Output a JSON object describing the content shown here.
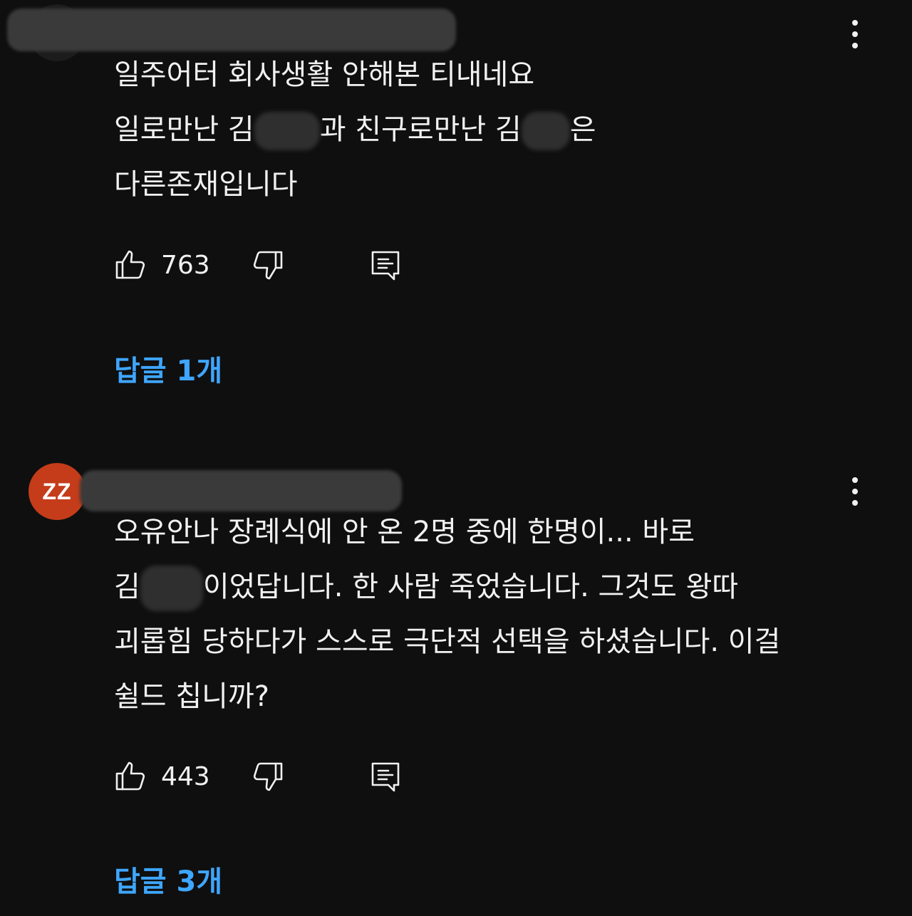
{
  "comments": [
    {
      "avatar_text": "",
      "avatar_color": "#1c1c1c",
      "lines": [
        {
          "parts": [
            "일주어터 회사생활 안해본 티내네요"
          ]
        },
        {
          "parts": [
            "일로만난 김",
            "과 친구로만난 김",
            "은"
          ]
        },
        {
          "parts": [
            "다른존재입니다"
          ]
        }
      ],
      "like_count": "763",
      "replies_label": "답글 1개"
    },
    {
      "avatar_text": "ZZ",
      "avatar_color": "#c53c1a",
      "lines": [
        {
          "parts": [
            "오유안나 장례식에 안 온 2명 중에 한명이... 바로"
          ]
        },
        {
          "parts": [
            "김",
            "이었답니다. 한 사람 죽었습니다. 그것도 왕따"
          ]
        },
        {
          "parts": [
            "괴롭힘 당하다가 스스로 극단적 선택을 하셨습니다. 이걸"
          ]
        },
        {
          "parts": [
            "쉴드 칩니까?"
          ]
        }
      ],
      "like_count": "443",
      "replies_label": "답글 3개"
    }
  ],
  "icons": {
    "like": "thumbs-up-icon",
    "dislike": "thumbs-down-icon",
    "reply": "reply-icon",
    "menu": "more-vert-icon"
  },
  "colors": {
    "background": "#0f0f0f",
    "text": "#f1f1f1",
    "link": "#3ea6ff"
  }
}
